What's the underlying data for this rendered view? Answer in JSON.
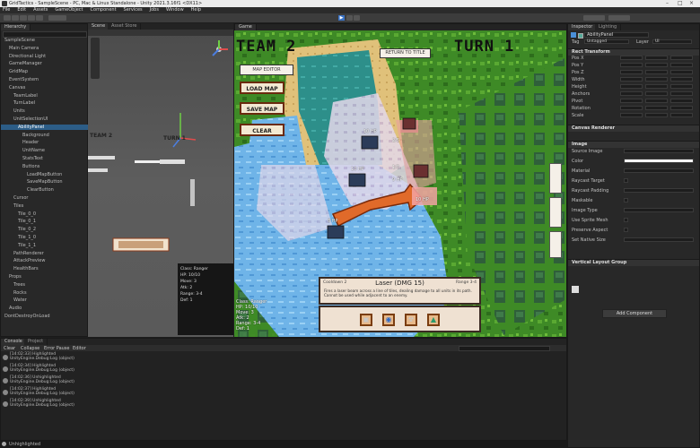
{
  "window": {
    "title": "GridTactics - SampleScene - PC, Mac & Linux Standalone - Unity 2021.3.16f1 <DX11>"
  },
  "menu": [
    "File",
    "Edit",
    "Assets",
    "GameObject",
    "Component",
    "Services",
    "Jobs",
    "Window",
    "Help"
  ],
  "tabs": {
    "hierarchy": "Hierarchy",
    "scene": "Scene",
    "asset_store": "Asset Store",
    "game": "Game",
    "inspector": "Inspector",
    "lighting": "Lighting",
    "console": "Console",
    "project": "Project"
  },
  "hierarchy_rows": [
    "SampleScene",
    "Main Camera",
    "Directional Light",
    "GameManager",
    "GridMap",
    "EventSystem",
    "Canvas",
    "TeamLabel",
    "TurnLabel",
    "Units",
    "UnitSelectionUI",
    "AbilityPanel",
    "Background",
    "Header",
    "UnitName",
    "StatsText",
    "Buttons",
    "LoadMapButton",
    "SaveMapButton",
    "ClearButton",
    "Cursor",
    "Tiles",
    "Tile_0_0",
    "Tile_0_1",
    "Tile_0_2",
    "Tile_1_0",
    "Tile_1_1",
    "PathRenderer",
    "AttackPreview",
    "HealthBars",
    "Props",
    "Trees",
    "Rocks",
    "Water",
    "Audio",
    "DontDestroyOnLoad"
  ],
  "game": {
    "team_label": "TEAM 2",
    "turn_label": "TURN 1",
    "return_button": "RETURN TO TITLE",
    "top_left_button": "MAP EDITOR",
    "load_button": "LOAD MAP",
    "save_button": "SAVE MAP",
    "clear_button": "CLEAR",
    "units": [
      {
        "hp": "10 HP",
        "atk": "2/5"
      },
      {
        "hp": "10 HP",
        "atk": "1/3"
      },
      {
        "hp": "9 HP",
        "atk": "2/4"
      },
      {
        "hp": "10 HP",
        "atk": "3/3"
      },
      {
        "hp": "8 HP",
        "atk": "1/2"
      }
    ],
    "ability_panel": {
      "title": "Laser (DMG 15)",
      "left_tag": "Cooldown 2",
      "right_tag": "Range 3-4",
      "description": "Fires a laser beam across a line of tiles, dealing damage to all units in its path. Cannot be used while adjacent to an enemy."
    },
    "stats_lines": [
      "Class: Ranger",
      "HP: 10/10",
      "Move: 3",
      "Atk: 2",
      "Range: 3-4",
      "Def: 1"
    ]
  },
  "console": {
    "toolbar": [
      "Clear",
      "Collapse",
      "Error Pause",
      "Editor"
    ],
    "messages": [
      {
        "l1": "[14:02:33] Highlighted",
        "l2": "UnityEngine.Debug:Log (object)"
      },
      {
        "l1": "[14:02:34] Highlighted",
        "l2": "UnityEngine.Debug:Log (object)"
      },
      {
        "l1": "[14:02:36] Unhighlighted",
        "l2": "UnityEngine.Debug:Log (object)"
      },
      {
        "l1": "[14:02:37] Highlighted",
        "l2": "UnityEngine.Debug:Log (object)"
      },
      {
        "l1": "[14:02:39] Unhighlighted",
        "l2": "UnityEngine.Debug:Log (object)"
      }
    ]
  },
  "inspector": {
    "object_name": "AbilityPanel",
    "tag_label": "Tag",
    "tag_value": "Untagged",
    "layer_label": "Layer",
    "layer_value": "UI",
    "sections": [
      "Rect Transform",
      "Canvas Renderer",
      "Image",
      "Vertical Layout Group"
    ],
    "rect_fields": [
      "Pos X",
      "Pos Y",
      "Pos Z",
      "Width",
      "Height",
      "Anchors",
      "Pivot",
      "Rotation",
      "Scale"
    ],
    "image_fields": [
      "Source Image",
      "Color",
      "Material",
      "Raycast Target",
      "Raycast Padding",
      "Maskable",
      "Image Type",
      "Use Sprite Mesh",
      "Preserve Aspect",
      "Set Native Size"
    ],
    "add_component": "Add Component"
  },
  "status_text": "Unhighlighted",
  "colors": {
    "editor_bg": "#282828",
    "selection": "#2c5d87",
    "play_blue": "#3a72c4",
    "button_border": "#6a2a0e",
    "button_fill": "#f3e9d2"
  }
}
